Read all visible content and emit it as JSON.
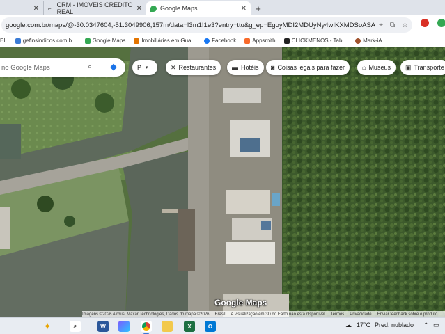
{
  "browser": {
    "tabs": [
      {
        "title": "",
        "active": false
      },
      {
        "title": "CRM - IMOVEIS CREDITO REAL",
        "active": false
      },
      {
        "title": "Google Maps",
        "active": true
      }
    ],
    "new_tab_label": "+",
    "url": "google.com.br/maps/@-30.0347604,-51.3049906,157m/data=!3m1!1e3?entry=ttu&g_ep=EgoyMDI2MDUyNy4wIKXMDSoASAFQA...",
    "bookmarks": [
      {
        "label": "EL",
        "color": "#777777"
      },
      {
        "label": "gefinsindicos.com.b...",
        "color": "#3a7bd5"
      },
      {
        "label": "Google Maps",
        "color": "#34a853"
      },
      {
        "label": "Imobiliárias em Gua...",
        "color": "#e37400"
      },
      {
        "label": "Facebook",
        "color": "#1877f2"
      },
      {
        "label": "Appsmith",
        "color": "#f86a2b"
      },
      {
        "label": "CLICKMENOS - Tab...",
        "color": "#222222"
      },
      {
        "label": "Mark-iA",
        "color": "#a0522d"
      }
    ]
  },
  "maps": {
    "search_placeholder": "no Google Maps",
    "parking_chip": "P",
    "chips": [
      {
        "label": "Restaurantes",
        "icon": "fork-knife-icon"
      },
      {
        "label": "Hotéis",
        "icon": "bed-icon"
      },
      {
        "label": "Coisas legais para fazer",
        "icon": "camera-icon"
      },
      {
        "label": "Museus",
        "icon": "museum-icon"
      },
      {
        "label": "Transporte",
        "icon": "transit-icon"
      }
    ],
    "logo_text": "Google Maps",
    "attribution": [
      "Imagens ©2026 Airbus, Maxar Technologies, Dados do mapa ©2026",
      "Brasil",
      "A visualização em 3D do Earth não está disponível",
      "Termos",
      "Privacidade",
      "Enviar feedback sobre o produto"
    ]
  },
  "taskbar": {
    "weather_temp": "17°C",
    "weather_text": "Pred. nublado"
  }
}
